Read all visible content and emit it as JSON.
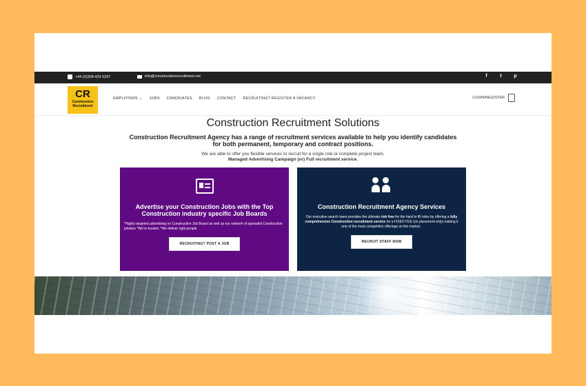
{
  "topbar": {
    "phone": "+44 (0)208 429 5297",
    "email": "info@constructionrecruitment.net",
    "social": [
      {
        "name": "facebook-icon",
        "glyph": "f"
      },
      {
        "name": "twitter-icon",
        "glyph": "t"
      },
      {
        "name": "pinterest-icon",
        "glyph": "p"
      }
    ]
  },
  "logo": {
    "initials": "CR",
    "line1": "Construction",
    "line2": "Recruitment"
  },
  "nav": {
    "items": [
      "EMPLOYERS ⌄",
      "JOBS",
      "CANDIDATES",
      "BLOG",
      "CONTACT",
      "RECRUITING? REGISTER A VACANCY"
    ],
    "login": "LOGIN/REGISTER"
  },
  "hero": {
    "title": "Construction Recruitment Solutions",
    "lead": "Construction Recruitment Agency has a range of recruitment services available to help you identify candidates for both permanent, temporary and contract positions.",
    "text_line1": "We are able to offer you flexible services to recruit for a single role or complete project team,",
    "text_line2": "Managed Advertising Campaign (or) Full recruitment service."
  },
  "cards": {
    "left": {
      "title": "Advertise your Construction Jobs with the Top Construction industry specific Job Boards",
      "desc": "*Highly targeted advertising on Construction Job Board as well as our network of specialist Construction jobsites *We're trusted. *We deliver right people",
      "button": "RECRUITING? POST A JOB"
    },
    "right": {
      "title": "Construction Recruitment Agency Services",
      "desc_pre": "Our executive search team provides the ultimate ",
      "desc_b1": "risk free",
      "desc_mid": " for the hard to fill roles by offering a ",
      "desc_b2": "fully comprehensive Construction recruitment service",
      "desc_post": " for a FIXED FEE (on placement only) making it one of the most competitive offerings on the market .",
      "button": "RECRUIT STAFF NOW"
    }
  },
  "colors": {
    "page_bg": "#ffba5c",
    "topbar": "#222222",
    "logo": "#f6c319",
    "card_purple": "#5f0a82",
    "card_navy": "#0e2444"
  }
}
